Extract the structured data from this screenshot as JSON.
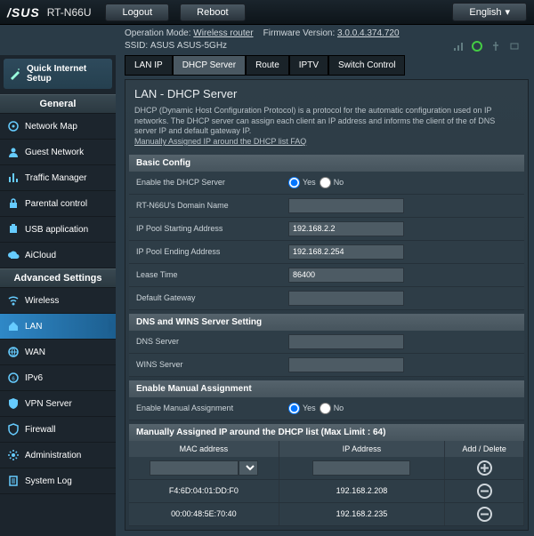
{
  "top": {
    "brand": "/SUS",
    "model": "RT-N66U",
    "logout": "Logout",
    "reboot": "Reboot",
    "language": "English"
  },
  "info": {
    "op_mode_label": "Operation Mode:",
    "op_mode_value": "Wireless router",
    "fw_label": "Firmware Version:",
    "fw_value": "3.0.0.4.374.720",
    "ssid_label": "SSID:",
    "ssid_24": "ASUS",
    "ssid_5": "ASUS-5GHz"
  },
  "quick": {
    "line1": "Quick Internet",
    "line2": "Setup"
  },
  "sections": {
    "general": "General",
    "advanced": "Advanced Settings"
  },
  "nav_general": [
    {
      "label": "Network Map"
    },
    {
      "label": "Guest Network"
    },
    {
      "label": "Traffic Manager"
    },
    {
      "label": "Parental control"
    },
    {
      "label": "USB application"
    },
    {
      "label": "AiCloud"
    }
  ],
  "nav_advanced": [
    {
      "label": "Wireless"
    },
    {
      "label": "LAN"
    },
    {
      "label": "WAN"
    },
    {
      "label": "IPv6"
    },
    {
      "label": "VPN Server"
    },
    {
      "label": "Firewall"
    },
    {
      "label": "Administration"
    },
    {
      "label": "System Log"
    }
  ],
  "tabs": [
    {
      "label": "LAN IP"
    },
    {
      "label": "DHCP Server"
    },
    {
      "label": "Route"
    },
    {
      "label": "IPTV"
    },
    {
      "label": "Switch Control"
    }
  ],
  "panel": {
    "title": "LAN - DHCP Server",
    "desc": "DHCP (Dynamic Host Configuration Protocol) is a protocol for the automatic configuration used on IP networks. The DHCP server can assign each client an IP address and informs the client of the of DNS server IP and default gateway IP.",
    "faq": "Manually Assigned IP around the DHCP list FAQ"
  },
  "basic": {
    "head": "Basic Config",
    "enable_label": "Enable the DHCP Server",
    "yes": "Yes",
    "no": "No",
    "domain_label": "RT-N66U's Domain Name",
    "domain_value": "",
    "start_label": "IP Pool Starting Address",
    "start_value": "192.168.2.2",
    "end_label": "IP Pool Ending Address",
    "end_value": "192.168.2.254",
    "lease_label": "Lease Time",
    "lease_value": "86400",
    "gateway_label": "Default Gateway",
    "gateway_value": ""
  },
  "dns": {
    "head": "DNS and WINS Server Setting",
    "dns_label": "DNS Server",
    "dns_value": "",
    "wins_label": "WINS Server",
    "wins_value": ""
  },
  "manual": {
    "head": "Enable Manual Assignment",
    "label": "Enable Manual Assignment",
    "yes": "Yes",
    "no": "No"
  },
  "iplist": {
    "head": "Manually Assigned IP around the DHCP list (Max Limit : 64)",
    "col_mac": "MAC address",
    "col_ip": "IP Address",
    "col_act": "Add / Delete",
    "rows": [
      {
        "mac": "F4:6D:04:01:DD:F0",
        "ip": "192.168.2.208"
      },
      {
        "mac": "00:00:48:5E:70:40",
        "ip": "192.168.2.235"
      }
    ]
  }
}
